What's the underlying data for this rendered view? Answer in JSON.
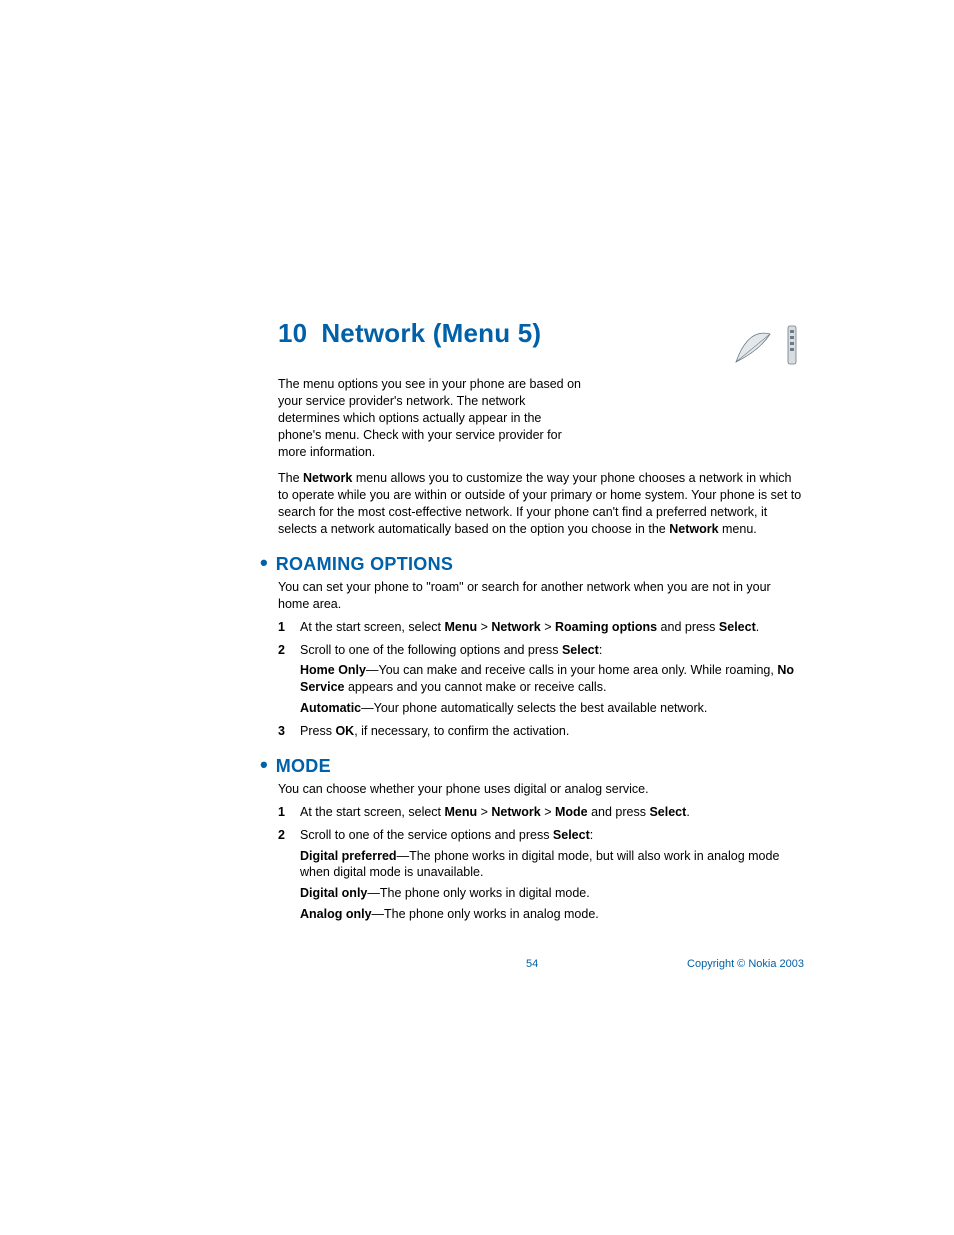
{
  "chapter_number": "10",
  "chapter_title": "Network (Menu 5)",
  "intro": "The menu options you see in your phone are based on your service provider's network. The network determines which options actually appear in the phone's menu. Check with your service provider for more information.",
  "network_para_a": "The ",
  "network_para_b": "Network",
  "network_para_c": " menu allows you to customize the way your phone chooses a network in which to operate while you are within or outside of your primary or home system. Your phone is set to search for the most cost-effective network. If your phone can't find a preferred network, it selects a network automatically based on the option you choose in the ",
  "network_para_d": "Network",
  "network_para_e": " menu.",
  "roaming": {
    "heading": "ROAMING OPTIONS",
    "intro": "You can set your phone to \"roam\" or search for another network when you are not in your home area.",
    "step1_a": "At the start screen, select ",
    "step1_b": "Menu",
    "step1_c": " > ",
    "step1_d": "Network",
    "step1_e": " > ",
    "step1_f": "Roaming options",
    "step1_g": " and press ",
    "step1_h": "Select",
    "step1_i": ".",
    "step2_a": "Scroll to one of the following options and press ",
    "step2_b": "Select",
    "step2_c": ":",
    "home_only_label": "Home Only",
    "home_only_text_a": "—You can make and receive calls in your home area only. While roaming, ",
    "home_only_text_b": "No Service",
    "home_only_text_c": " appears and you cannot make or receive calls.",
    "automatic_label": "Automatic",
    "automatic_text": "—Your phone automatically selects the best available network.",
    "step3_a": "Press ",
    "step3_b": "OK",
    "step3_c": ", if necessary, to confirm the activation."
  },
  "mode": {
    "heading": "MODE",
    "intro": "You can choose whether your phone uses digital or analog service.",
    "step1_a": "At the start screen, select ",
    "step1_b": "Menu",
    "step1_c": " > ",
    "step1_d": "Network",
    "step1_e": " > ",
    "step1_f": "Mode",
    "step1_g": " and press ",
    "step1_h": "Select",
    "step1_i": ".",
    "step2_a": "Scroll to one of the service options and press ",
    "step2_b": "Select",
    "step2_c": ":",
    "dp_label": "Digital preferred",
    "dp_text": "—The phone works in digital mode, but will also work in analog mode when digital mode is unavailable.",
    "do_label": "Digital only",
    "do_text": "—The phone only works in digital mode.",
    "ao_label": "Analog only",
    "ao_text": "—The phone only works in analog mode."
  },
  "footer": {
    "page": "54",
    "copyright": "Copyright © Nokia 2003"
  }
}
